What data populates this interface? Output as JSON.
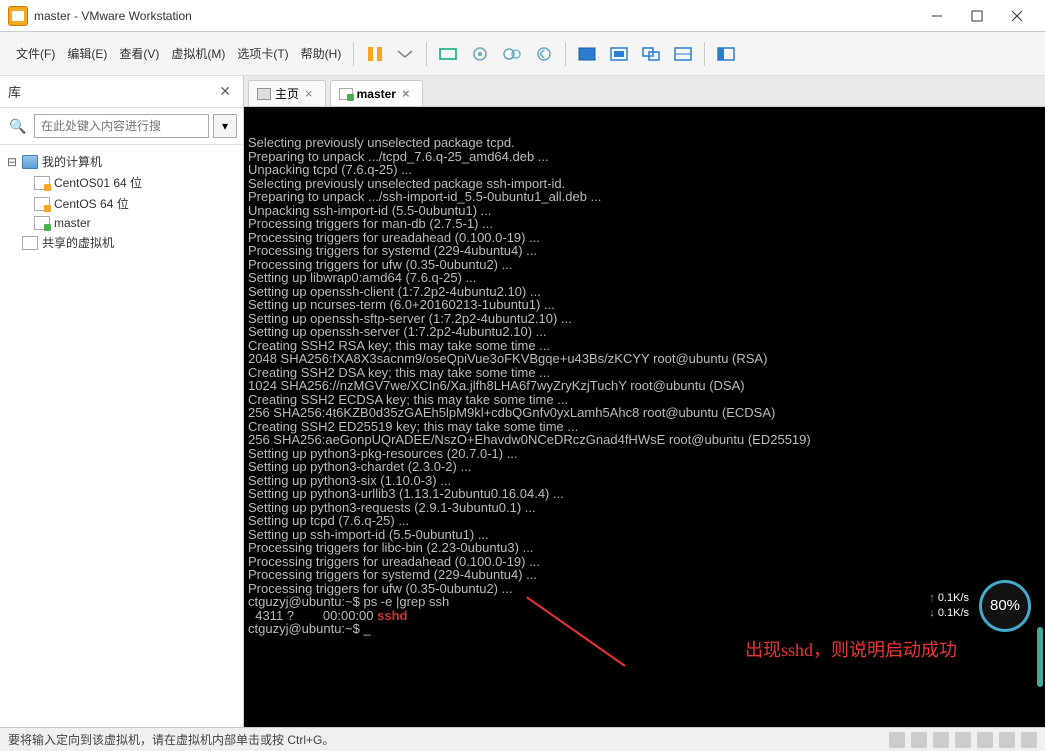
{
  "window": {
    "title": "master - VMware Workstation"
  },
  "menubar": {
    "file": "文件(F)",
    "edit": "编辑(E)",
    "view": "查看(V)",
    "vm": "虚拟机(M)",
    "tabs": "选项卡(T)",
    "help": "帮助(H)"
  },
  "sidebar": {
    "library_title": "库",
    "search_placeholder": "在此处键入内容进行搜",
    "root": "我的计算机",
    "items": [
      {
        "label": "CentOS01 64 位",
        "type": "vm"
      },
      {
        "label": "CentOS 64 位",
        "type": "vm"
      },
      {
        "label": "master",
        "type": "vm",
        "active": true
      }
    ],
    "shared": "共享的虚拟机"
  },
  "tabs": {
    "home": "主页",
    "master": "master"
  },
  "terminal": {
    "lines": [
      "Selecting previously unselected package tcpd.",
      "Preparing to unpack .../tcpd_7.6.q-25_amd64.deb ...",
      "Unpacking tcpd (7.6.q-25) ...",
      "Selecting previously unselected package ssh-import-id.",
      "Preparing to unpack .../ssh-import-id_5.5-0ubuntu1_all.deb ...",
      "Unpacking ssh-import-id (5.5-0ubuntu1) ...",
      "Processing triggers for man-db (2.7.5-1) ...",
      "Processing triggers for ureadahead (0.100.0-19) ...",
      "Processing triggers for systemd (229-4ubuntu4) ...",
      "Processing triggers for ufw (0.35-0ubuntu2) ...",
      "Setting up libwrap0:amd64 (7.6.q-25) ...",
      "Setting up openssh-client (1:7.2p2-4ubuntu2.10) ...",
      "Setting up ncurses-term (6.0+20160213-1ubuntu1) ...",
      "Setting up openssh-sftp-server (1:7.2p2-4ubuntu2.10) ...",
      "Setting up openssh-server (1:7.2p2-4ubuntu2.10) ...",
      "Creating SSH2 RSA key; this may take some time ...",
      "2048 SHA256:fXA8X3sacnm9/oseQpiVue3oFKVBgqe+u43Bs/zKCYY root@ubuntu (RSA)",
      "Creating SSH2 DSA key; this may take some time ...",
      "1024 SHA256://nzMGV7we/XCIn6/Xa.jlfh8LHA6f7wyZryKzjTuchY root@ubuntu (DSA)",
      "Creating SSH2 ECDSA key; this may take some time ...",
      "256 SHA256:4t6KZB0d35zGAEh5lpM9kl+cdbQGnfv0yxLamh5Ahc8 root@ubuntu (ECDSA)",
      "Creating SSH2 ED25519 key; this may take some time ...",
      "256 SHA256:aeGonpUQrADEE/NszO+Ehavdw0NCeDRczGnad4fHWsE root@ubuntu (ED25519)",
      "Setting up python3-pkg-resources (20.7.0-1) ...",
      "Setting up python3-chardet (2.3.0-2) ...",
      "Setting up python3-six (1.10.0-3) ...",
      "Setting up python3-urllib3 (1.13.1-2ubuntu0.16.04.4) ...",
      "Setting up python3-requests (2.9.1-3ubuntu0.1) ...",
      "Setting up tcpd (7.6.q-25) ...",
      "Setting up ssh-import-id (5.5-0ubuntu1) ...",
      "Processing triggers for libc-bin (2.23-0ubuntu3) ...",
      "Processing triggers for ureadahead (0.100.0-19) ...",
      "Processing triggers for systemd (229-4ubuntu4) ...",
      "Processing triggers for ufw (0.35-0ubuntu2) ..."
    ],
    "prompt1_full": "ctguzyj@ubuntu:~$ ps -e |grep ssh",
    "result_line": "  4311 ?        00:00:00 ",
    "result_proc": "sshd",
    "prompt2": "ctguzyj@ubuntu:~$ _"
  },
  "annotation": "出现sshd，则说明启动成功",
  "perf": {
    "up": "0.1K/s",
    "down": "0.1K/s",
    "cpu": "80%"
  },
  "statusbar": {
    "msg": "要将输入定向到该虚拟机，请在虚拟机内部单击或按 Ctrl+G。"
  }
}
